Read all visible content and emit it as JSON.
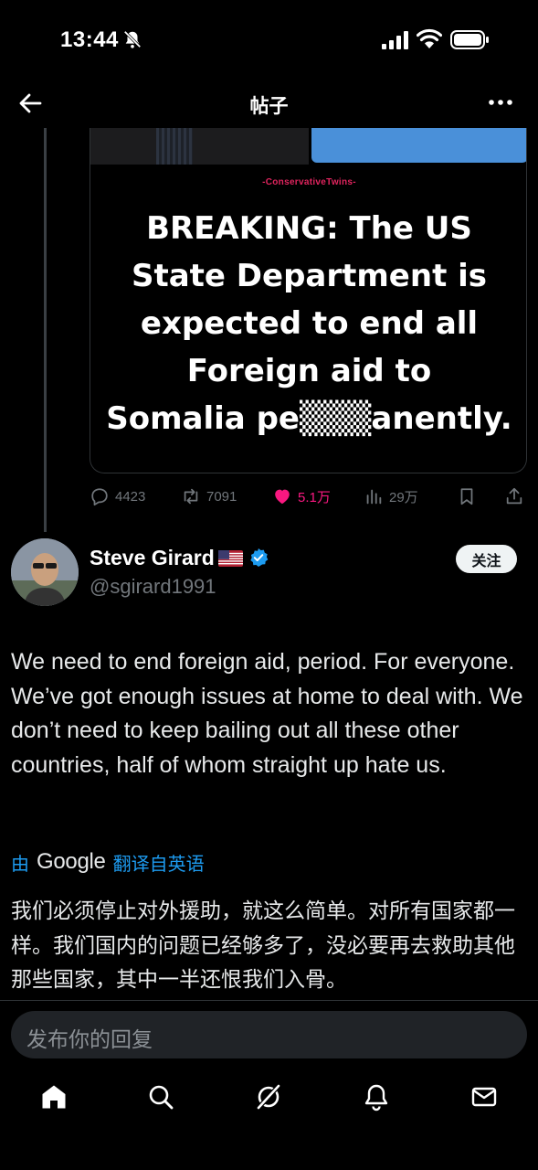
{
  "status_bar": {
    "time": "13:44"
  },
  "nav": {
    "title": "帖子",
    "back_icon": "arrow-left-icon",
    "more_icon": "more-dots-icon"
  },
  "media": {
    "watermark": "-ConservativeTwins-",
    "headline_lines": [
      "BREAKING: The US",
      "State Department is",
      "expected to end all",
      "Foreign aid to",
      "Somalia pe▒▒▒anently."
    ]
  },
  "actions": {
    "replies": "4423",
    "reposts": "7091",
    "likes": "5.1万",
    "views": "29万"
  },
  "author": {
    "name": "Steve Girard",
    "handle": "@sgirard1991",
    "follow_label": "关注"
  },
  "tweet": {
    "text": "We need to end foreign aid, period. For everyone. We’ve got enough issues at home to deal with. We don’t need to keep bailing out all these other countries, half of whom straight up hate us."
  },
  "translation": {
    "prefix": "由",
    "provider": "Google",
    "suffix": "翻译自英语",
    "text": "我们必须停止对外援助，就这么简单。对所有国家都一样。我们国内的问题已经够多了，没必要再去救助其他那些国家，其中一半还恨我们入骨。"
  },
  "reply": {
    "placeholder": "发布你的回复"
  },
  "colors": {
    "accent": "#1d9bf0",
    "like": "#f91880",
    "muted": "#71767b"
  }
}
